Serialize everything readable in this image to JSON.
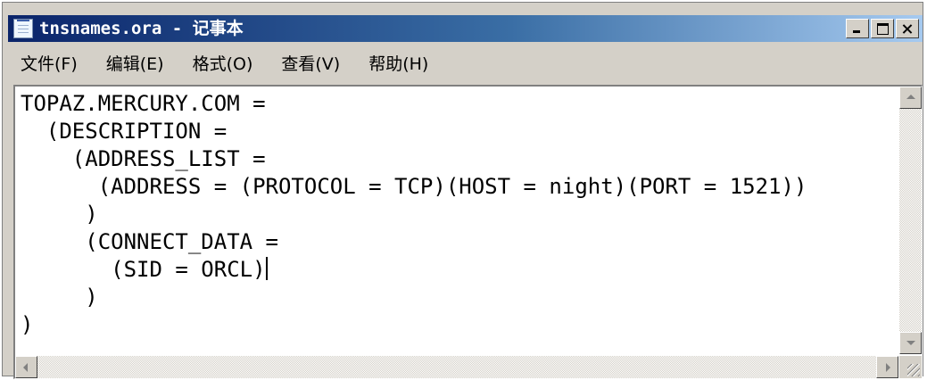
{
  "window": {
    "title": "tnsnames.ora - 记事本"
  },
  "menu": {
    "items": [
      "文件(F)",
      "编辑(E)",
      "格式(O)",
      "查看(V)",
      "帮助(H)"
    ]
  },
  "editor": {
    "lines": [
      "TOPAZ.MERCURY.COM =",
      "  (DESCRIPTION =",
      "    (ADDRESS_LIST =",
      "      (ADDRESS = (PROTOCOL = TCP)(HOST = night)(PORT = 1521))",
      "     )",
      "     (CONNECT_DATA =",
      "       (SID = ORCL)",
      "     )",
      ")"
    ]
  },
  "colors": {
    "titlebar_start": "#0a246a",
    "titlebar_end": "#a6caf0",
    "chrome": "#d4d0c8"
  }
}
